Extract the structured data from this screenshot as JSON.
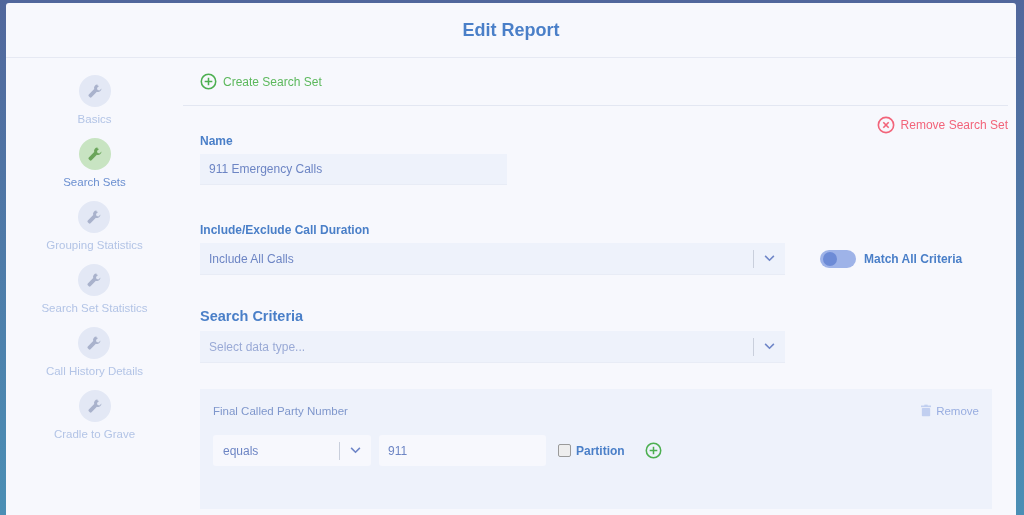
{
  "dialog": {
    "title": "Edit Report"
  },
  "steps": [
    {
      "label": "Basics",
      "selected": false
    },
    {
      "label": "Search Sets",
      "selected": true
    },
    {
      "label": "Grouping Statistics",
      "selected": false
    },
    {
      "label": "Search Set Statistics",
      "selected": false
    },
    {
      "label": "Call History Details",
      "selected": false
    },
    {
      "label": "Cradle to Grave",
      "selected": false
    }
  ],
  "create_button": "Create Search Set",
  "remove_set_button": "Remove Search Set",
  "name": {
    "label": "Name",
    "value": "911 Emergency Calls"
  },
  "duration": {
    "label": "Include/Exclude Call Duration",
    "value": "Include All Calls"
  },
  "match_all": {
    "label": "Match All Criteria",
    "on": false
  },
  "search_criteria": {
    "heading": "Search Criteria",
    "placeholder": "Select data type..."
  },
  "criteria": [
    {
      "title": "Final Called Party Number",
      "remove": "Remove",
      "operator": "equals",
      "value": "911",
      "partition": {
        "label": "Partition",
        "checked": false
      }
    }
  ]
}
